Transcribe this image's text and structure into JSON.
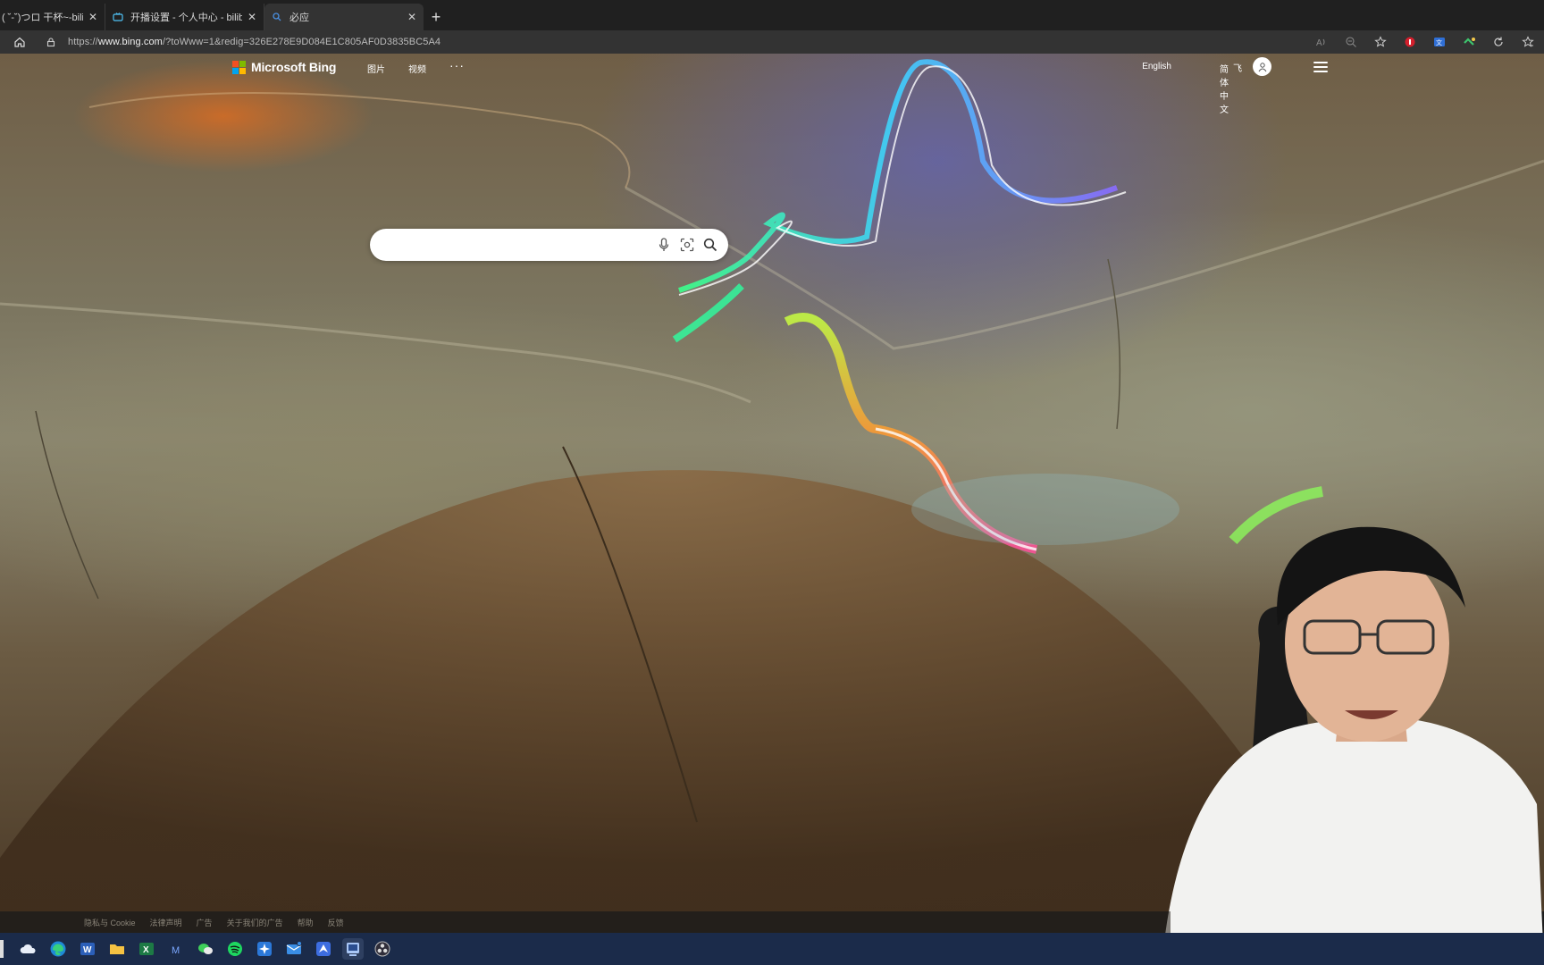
{
  "browser": {
    "tabs": [
      {
        "label": "( ˘‐˘)つロ 干杯~-bilib",
        "active": false
      },
      {
        "label": "开播设置 - 个人中心 - bilibili link",
        "active": false
      },
      {
        "label": "必应",
        "active": true
      }
    ],
    "url_prefix": "https://",
    "url_host": "www.bing.com",
    "url_rest": "/?toWww=1&redig=326E278E9D084E1C805AF0D3835BC5A4"
  },
  "bing": {
    "logo_text": "Microsoft Bing",
    "nav": [
      "图片",
      "视频",
      "···"
    ],
    "lang_english": "English",
    "lang_chinese": "简体中文",
    "rewards": "飞",
    "search_placeholder": ""
  },
  "footer": {
    "links": [
      "隐私与 Cookie",
      "法律声明",
      "广告",
      "关于我们的广告",
      "帮助",
      "反馈"
    ]
  },
  "colors": {
    "tab_bg": "#202020",
    "active_tab_bg": "#333333",
    "addr_bg": "#333333",
    "taskbar_bg": "#1b2b4a",
    "bing_logo": [
      "#f25022",
      "#7fba00",
      "#00a4ef",
      "#ffb900"
    ]
  }
}
